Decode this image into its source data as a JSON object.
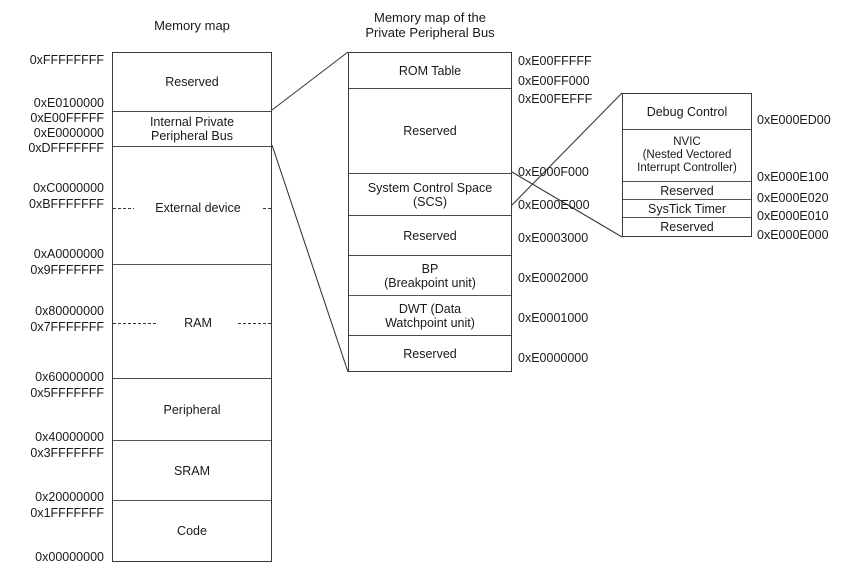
{
  "diagram": {
    "kind": "memory-map",
    "titles": {
      "left": "Memory map",
      "middle": "Memory map of the\nPrivate Peripheral Bus"
    }
  },
  "left_map": {
    "regions": [
      {
        "label": "Reserved"
      },
      {
        "label": "Internal Private\nPeripheral Bus"
      },
      {
        "label": "External device"
      },
      {
        "label": "RAM"
      },
      {
        "label": "Peripheral"
      },
      {
        "label": "SRAM"
      },
      {
        "label": "Code"
      }
    ],
    "addresses": [
      "0xFFFFFFFF",
      "0xE0100000",
      "0xE00FFFFF",
      "0xE0000000",
      "0xDFFFFFFF",
      "0xC0000000",
      "0xBFFFFFFF",
      "0xA0000000",
      "0x9FFFFFFF",
      "0x80000000",
      "0x7FFFFFFF",
      "0x60000000",
      "0x5FFFFFFF",
      "0x40000000",
      "0x3FFFFFFF",
      "0x20000000",
      "0x1FFFFFFF",
      "0x00000000"
    ]
  },
  "ppb_map": {
    "regions": [
      {
        "label": "ROM Table"
      },
      {
        "label": "Reserved"
      },
      {
        "label": "System Control Space\n(SCS)"
      },
      {
        "label": "Reserved"
      },
      {
        "label": "BP\n(Breakpoint unit)"
      },
      {
        "label": "DWT (Data\nWatchpoint unit)"
      },
      {
        "label": "Reserved"
      }
    ],
    "addresses": [
      "0xE00FFFFF",
      "0xE00FF000",
      "0xE00FEFFF",
      "0xE000F000",
      "0xE000E000",
      "0xE0003000",
      "0xE0002000",
      "0xE0001000",
      "0xE0000000"
    ]
  },
  "scs_map": {
    "regions": [
      {
        "label": "Debug Control"
      },
      {
        "label": "NVIC\n(Nested Vectored\nInterrupt Controller)"
      },
      {
        "label": "Reserved"
      },
      {
        "label": "SysTick Timer"
      },
      {
        "label": "Reserved"
      }
    ],
    "addresses": [
      "0xE000ED00",
      "0xE000E100",
      "0xE000E020",
      "0xE000E010",
      "0xE000E000"
    ]
  },
  "colors": {
    "stroke": "#3a3a3a",
    "divider": "#555555",
    "text": "#1a1a1a",
    "background": "#ffffff"
  }
}
